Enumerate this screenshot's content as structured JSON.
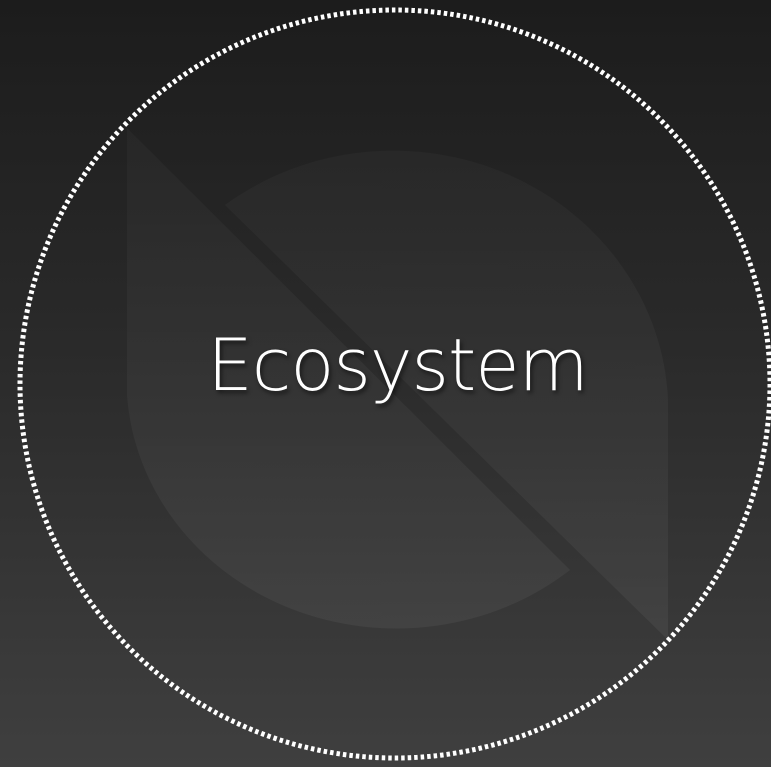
{
  "main": {
    "title": "Ecosystem"
  },
  "colors": {
    "background_top": "#1c1c1c",
    "background_bottom": "#3f3f3f",
    "ring": "#ffffff",
    "text": "#ffffff"
  },
  "icons": {
    "background_mark": "logo-watermark-icon",
    "ring": "dotted-circle-icon"
  }
}
